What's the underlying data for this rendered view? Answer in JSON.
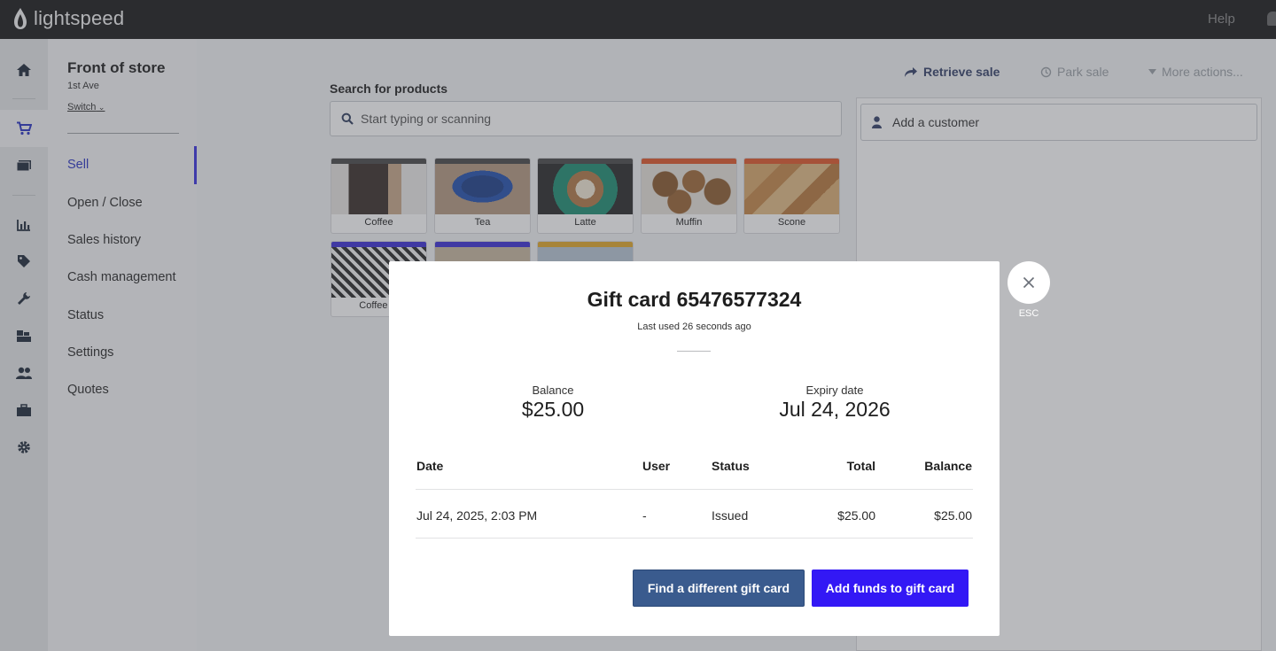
{
  "brand": {
    "name": "lightspeed"
  },
  "topbar": {
    "help_label": "Help"
  },
  "rail": {
    "icons": [
      "home-icon",
      "cart-icon",
      "register-icon",
      "chart-icon",
      "tag-icon",
      "wrench-icon",
      "inventory-icon",
      "customers-icon",
      "briefcase-icon",
      "gear-icon"
    ]
  },
  "store": {
    "name": "Front of store",
    "location": "1st Ave",
    "switch_label": "Switch"
  },
  "nav": {
    "items": [
      {
        "label": "Sell"
      },
      {
        "label": "Open / Close"
      },
      {
        "label": "Sales history"
      },
      {
        "label": "Cash management"
      },
      {
        "label": "Status"
      },
      {
        "label": "Settings"
      },
      {
        "label": "Quotes"
      }
    ]
  },
  "search": {
    "label": "Search for products",
    "placeholder": "Start typing or scanning"
  },
  "products": [
    {
      "name": "Coffee",
      "strip_color": "#4a4a4a"
    },
    {
      "name": "Tea",
      "strip_color": "#4a4a4a"
    },
    {
      "name": "Latte",
      "strip_color": "#4a4a4a"
    },
    {
      "name": "Muffin",
      "strip_color": "#e0582a"
    },
    {
      "name": "Scone",
      "strip_color": "#e0582a"
    },
    {
      "name": "Coffee M",
      "strip_color": "#3c2fd6"
    },
    {
      "name": "",
      "strip_color": "#3c2fd6"
    },
    {
      "name": "",
      "strip_color": "#e3a92a"
    }
  ],
  "toolbar": {
    "retrieve_label": "Retrieve sale",
    "park_label": "Park sale",
    "more_label": "More actions..."
  },
  "cart": {
    "customer_placeholder": "Add a customer"
  },
  "modal": {
    "title": "Gift card 65476577324",
    "subtitle": "Last used 26 seconds ago",
    "balance_label": "Balance",
    "balance_value": "$25.00",
    "expiry_label": "Expiry date",
    "expiry_value": "Jul 24, 2026",
    "table": {
      "headers": {
        "date": "Date",
        "user": "User",
        "status": "Status",
        "total": "Total",
        "balance": "Balance"
      },
      "rows": [
        {
          "date": "Jul 24, 2025, 2:03 PM",
          "user": "-",
          "status": "Issued",
          "total": "$25.00",
          "balance": "$25.00"
        }
      ]
    },
    "find_button_label": "Find a different gift card",
    "add_funds_button_label": "Add funds to gift card",
    "close_hint": "ESC"
  },
  "colors": {
    "accent": "#3318f5",
    "secondary_button": "#3a5b8e",
    "topbar": "#1a1a1a",
    "nav_active": "#2b35c4"
  }
}
